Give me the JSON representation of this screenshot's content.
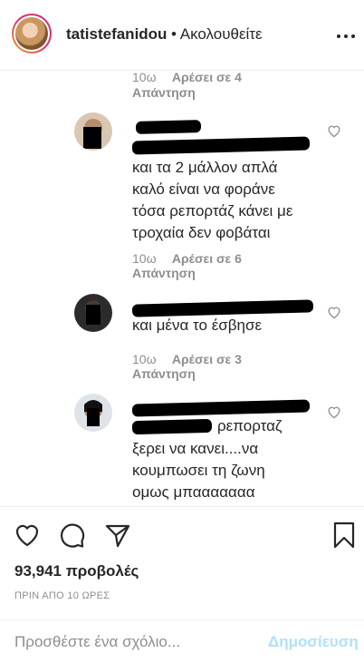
{
  "header": {
    "username": "tatistefanidou",
    "follow_status": "• Ακολουθείτε"
  },
  "thread": {
    "top_meta": {
      "time": "10ω",
      "likes": "Αρέσει σε 4"
    },
    "top_reply": "Απάντηση",
    "comments": [
      {
        "text_lines": [
          "και τα 2 μάλλον απλά",
          "καλό είναι να φοράνε",
          "τόσα ρεπορτάζ κάνει με",
          "τροχαία δεν φοβάται"
        ],
        "time": "10ω",
        "likes": "Αρέσει σε 6",
        "reply": "Απάντηση"
      },
      {
        "text_lines": [
          "και μένα το έσβησε"
        ],
        "time": "10ω",
        "likes": "Αρέσει σε 3",
        "reply": "Απάντηση"
      },
      {
        "text_first_suffix": "ρεπορταζ",
        "text_lines": [
          "ξερει να κανει....να",
          "κουμπωσει τη ζωνη",
          "ομως μπααααααα"
        ]
      }
    ]
  },
  "actions": {
    "views": "93,941 προβολές",
    "timestamp": "ΠΡΙΝ ΑΠΟ 10 ΩΡΕΣ"
  },
  "comment_box": {
    "placeholder": "Προσθέστε ένα σχόλιο...",
    "post_label": "Δημοσίευση"
  },
  "colors": {
    "text": "#262626",
    "secondary": "#8e8e8e",
    "post_disabled": "#b2dffc"
  }
}
